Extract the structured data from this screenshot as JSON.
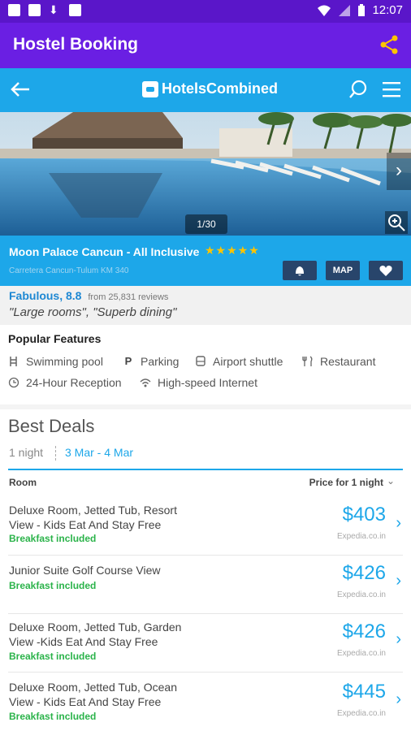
{
  "status_bar": {
    "time": "12:07"
  },
  "app_bar": {
    "title": "Hostel Booking"
  },
  "header": {
    "logo_text": "HotelsCombined"
  },
  "gallery": {
    "counter": "1/30"
  },
  "hotel": {
    "name": "Moon Palace Cancun - All Inclusive",
    "stars": "★★★★★",
    "address": "Carretera Cancun-Tulum KM 340",
    "map_label": "MAP"
  },
  "review": {
    "rating": "Fabulous, 8.8",
    "count": "from 25,831 reviews",
    "quote": "\"Large rooms\", \"Superb dining\""
  },
  "features": {
    "title": "Popular Features",
    "items": [
      "Swimming pool",
      "Parking",
      "Airport shuttle",
      "Restaurant",
      "24-Hour Reception",
      "High-speed Internet"
    ]
  },
  "deals": {
    "title": "Best Deals",
    "nights": "1 night",
    "dates": "3 Mar - 4 Mar",
    "col_room": "Room",
    "col_price": "Price for 1 night",
    "rooms": [
      {
        "name": "Deluxe Room, Jetted Tub, Resort View - Kids Eat And Stay Free",
        "perk": "Breakfast included",
        "price": "$403",
        "source": "Expedia.co.in"
      },
      {
        "name": "Junior Suite Golf Course View",
        "perk": "Breakfast included",
        "price": "$426",
        "source": "Expedia.co.in"
      },
      {
        "name": "Deluxe Room, Jetted Tub, Garden View -Kids Eat And Stay Free",
        "perk": "Breakfast included",
        "price": "$426",
        "source": "Expedia.co.in"
      },
      {
        "name": "Deluxe Room, Jetted Tub, Ocean View - Kids Eat And Stay Free",
        "perk": "Breakfast included",
        "price": "$445",
        "source": "Expedia.co.in"
      }
    ]
  },
  "colors": {
    "app_purple": "#6a1fe3",
    "brand_blue": "#1da7e9",
    "star_gold": "#ffc400",
    "perk_green": "#2bb34a",
    "button_navy": "#28456b"
  }
}
